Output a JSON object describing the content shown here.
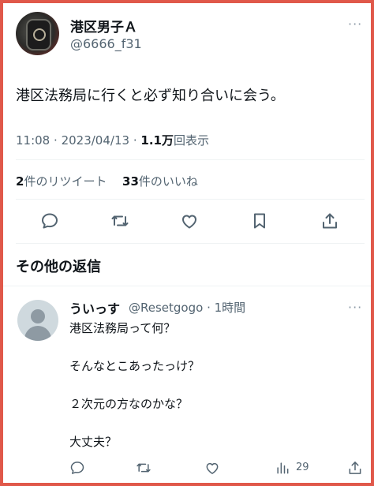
{
  "tweet": {
    "display_name": "港区男子Ａ",
    "handle": "@6666_f31",
    "more_glyph": "···",
    "text": "港区法務局に行くと必ず知り合いに会う。",
    "time": "11:08",
    "sep1": "·",
    "date": "2023/04/13",
    "sep2": "·",
    "views_count": "1.1万",
    "views_label": "回表示",
    "retweets_count": "2",
    "retweets_label": "件のリツイート",
    "likes_count": "33",
    "likes_label": "件のいいね",
    "actions": [
      "reply-icon",
      "retweet-icon",
      "like-icon",
      "bookmark-icon",
      "share-icon"
    ]
  },
  "section": {
    "title": "その他の返信"
  },
  "reply": {
    "display_name": "ういっす",
    "handle_time": "@Resetgogo · 1時間",
    "more_glyph": "···",
    "lines": [
      "港区法務局って何？",
      "そんなとこあったっけ？",
      "２次元の方なのかな？",
      "大丈夫？"
    ],
    "views_count": "29",
    "actions": [
      "reply-icon",
      "retweet-icon",
      "like-icon",
      "views-icon",
      "share-icon"
    ]
  },
  "colors": {
    "border": "#e0584a",
    "muted": "#536471",
    "text": "#0f1419",
    "divider": "#eff3f4"
  }
}
